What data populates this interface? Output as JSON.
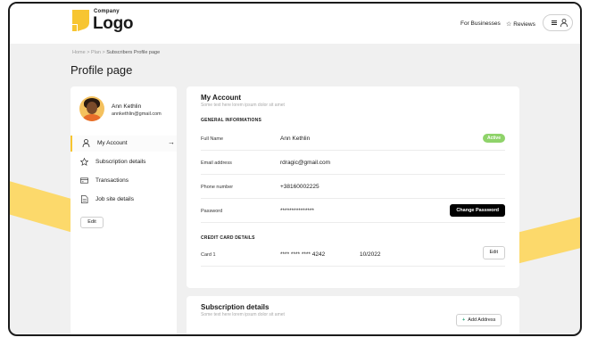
{
  "header": {
    "brand_small": "Company",
    "brand_big": "Logo",
    "nav": {
      "for_businesses": "For Businesses",
      "reviews": "Reviews"
    },
    "icons": [
      "star-icon",
      "hamburger-icon",
      "user-icon"
    ]
  },
  "breadcrumb": {
    "home": "Home",
    "sep1": ">",
    "plan": "Plan",
    "sep2": ">",
    "current": "Subscribers Profile page"
  },
  "page_title": "Profile page",
  "sidebar": {
    "user": {
      "name": "Ann Kethlin",
      "email": "annkethlin@gmail.com"
    },
    "items": [
      {
        "label": "My Account",
        "icon": "user-icon",
        "active": true
      },
      {
        "label": "Subscription details",
        "icon": "star-icon",
        "active": false
      },
      {
        "label": "Transactions",
        "icon": "card-icon",
        "active": false
      },
      {
        "label": "Job site details",
        "icon": "document-icon",
        "active": false
      }
    ],
    "edit_label": "Edit"
  },
  "account": {
    "title": "My Account",
    "subtitle": "Some text here lorem ipsum dolor sit amet",
    "general_head": "GENERAL INFORMATIONS",
    "rows": {
      "full_name": {
        "key": "Full Name",
        "value": "Ann Kethlin",
        "badge": "Active"
      },
      "email": {
        "key": "Email address",
        "value": "rdragic@gmail.com"
      },
      "phone": {
        "key": "Phone number",
        "value": "+38160002225"
      },
      "password": {
        "key": "Password",
        "value": "***************",
        "button": "Change Password"
      }
    },
    "card_head": "CREDIT CARD DETAILS",
    "card": {
      "key": "Card 1",
      "number": "**** **** **** 4242",
      "expiry": "10/2022",
      "button": "Edit"
    }
  },
  "subscription": {
    "title": "Subscription details",
    "subtitle": "Some text here lorem ipsum dolor sit amet",
    "add_button": "Add Address"
  },
  "colors": {
    "accent": "#f7c531",
    "active_badge": "#8fd36a",
    "background": "#f0f0f0"
  }
}
